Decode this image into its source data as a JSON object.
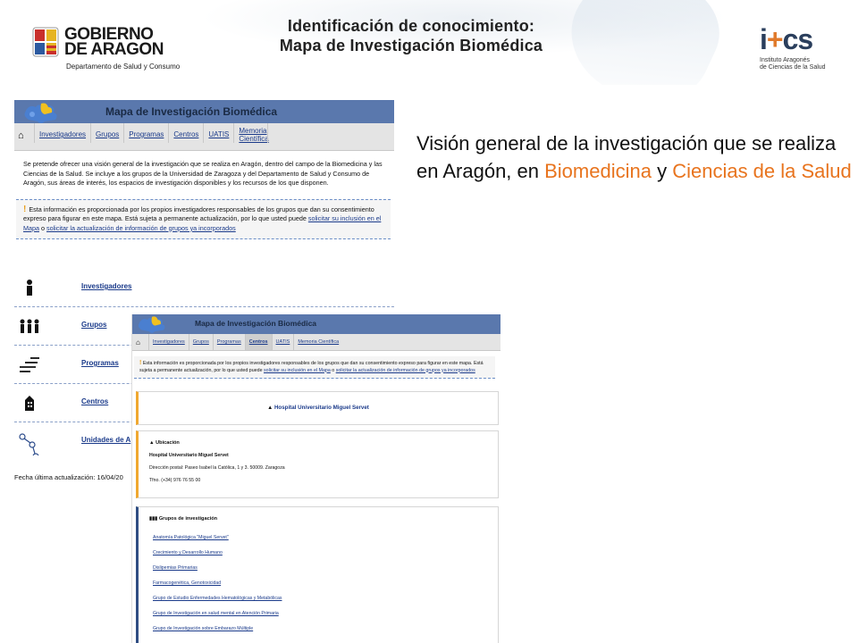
{
  "header": {
    "title_line1": "Identificación de conocimiento:",
    "title_line2": "Mapa de Investigación Biomédica"
  },
  "logos": {
    "gobierno_line1": "GOBIERNO",
    "gobierno_line2": "DE ARAGON",
    "gobierno_dept": "Departamento de Salud y Consumo",
    "ics_mark_i": "i",
    "ics_mark_plus": "+",
    "ics_mark_cs": "cs",
    "ics_sub_line1": "Instituto Aragonés",
    "ics_sub_line2": "de Ciencias de la Salud"
  },
  "overview": {
    "prefix": "Visión general de la investigación que se realiza en Aragón, en ",
    "highlight1": "Biomedicina",
    "middle": " y ",
    "highlight2": "Ciencias de la Salud",
    "highlight_color": "#e8741e"
  },
  "shot1": {
    "banner_title": "Mapa de Investigación Biomédica",
    "nav": [
      "Investigadores",
      "Grupos",
      "Programas",
      "Centros",
      "UATIS",
      "Memoria Científica"
    ],
    "intro": "Se pretende ofrecer una visión general de la investigación que se realiza en Aragón, dentro del campo de la Biomedicina y las Ciencias de la Salud. Se incluye a los grupos de la Universidad de Zaragoza y del Departamento de Salud y Consumo de Aragón, sus áreas de interés, los espacios de investigación disponibles y los recursos de los que disponen.",
    "notice_text": "Esta información es proporcionada por los propios investigadores responsables de los grupos que dan su consentimiento expreso para figurar en este mapa. Está sujeta a permanente actualización, por lo que usted puede ",
    "notice_link1": "solicitar su inclusión en el Mapa",
    "notice_or": " o ",
    "notice_link2": "solicitar la actualización de información de grupos ya incorporados",
    "rows": [
      "Investigadores",
      "Grupos",
      "Programas",
      "Centros",
      "Unidades de A"
    ],
    "updated": "Fecha última actualización: 16/04/20"
  },
  "shot2": {
    "banner_title": "Mapa de Investigación Biomédica",
    "nav": [
      "Investigadores",
      "Grupos",
      "Programas",
      "Centros",
      "UATIS",
      "Memoria Científica"
    ],
    "active_tab": "Centros",
    "notice_text": "Esta información es proporcionada por los propios investigadores responsables de los grupos que dan su consentimiento expreso para figurar en este mapa. Está sujeta a permanente actualización, por lo que usted puede ",
    "notice_link1": "solicitar su inclusión en el Mapa",
    "notice_or": " o ",
    "notice_link2": "solicitar la actualización de información de grupos ya incorporados",
    "center_name": "Hospital Universitario Miguel Servet",
    "location_head": "Ubicación",
    "location_name": "Hospital Universitario Miguel Servet",
    "address": "Dirección postal: Paseo Isabel la Católica, 1 y 3. 50009. Zaragoza",
    "phone": "Tfno. (+34) 976 76 55 00",
    "groups_head": "Grupos de investigación",
    "groups": [
      "Anatomía Patológica \"Miguel Servet\"",
      "Crecimiento y Desarrollo Humano",
      "Dislipemias Primarias",
      "Farmacogenética, Genotoxicidad",
      "Grupo de Estudio Enfermedades Hematológicas y Metabólicas",
      "Grupo de Investigación en salud mental en Atención Primaria",
      "Grupo de Investigación sobre Embarazo Múltiple"
    ]
  }
}
